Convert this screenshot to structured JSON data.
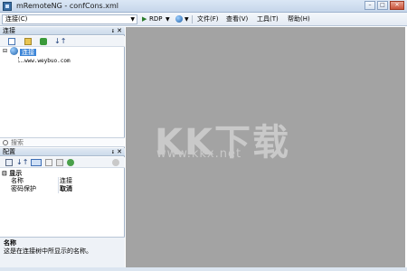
{
  "window": {
    "title": "mRemoteNG - confCons.xml",
    "min": "–",
    "max": "□",
    "close": "✕"
  },
  "toolbar": {
    "connection_combo": "连接(C)",
    "rdp_label": "RDP",
    "menu": [
      "文件(F)",
      "查看(V)",
      "工具(T)",
      "帮助(H)"
    ]
  },
  "connections_panel": {
    "title": "连接",
    "pin": "ᵻ",
    "close": "✕",
    "tree_root": "连接",
    "tree_child": "www.weybuo.com",
    "search_placeholder": "搜索"
  },
  "config_panel": {
    "title": "配置",
    "pin": "ᵻ",
    "close": "✕",
    "group": "⊟ 显示",
    "rows": [
      {
        "key": "名称",
        "value": "连接"
      },
      {
        "key": "密码保护",
        "value": "取消"
      }
    ],
    "desc_title": "名称",
    "desc_text": "这是在连接树中所显示的名称。"
  },
  "watermark": {
    "logo": "KK下载",
    "url": "www.kkx.net"
  },
  "colors": {
    "main_bg": "#a3a3a3",
    "selection": "#3d86d8",
    "panel_header": "#dfe8f3"
  }
}
